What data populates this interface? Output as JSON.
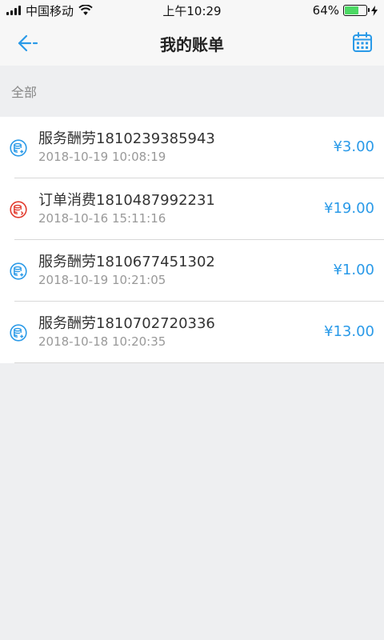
{
  "status_bar": {
    "carrier": "中国移动",
    "time": "上午10:29",
    "battery": "64%",
    "battery_level": 0.64,
    "signal_icon": "signal-icon",
    "wifi_icon": "wifi-icon",
    "charging_icon": "bolt-icon"
  },
  "navbar": {
    "title": "我的账单",
    "back_icon": "back-arrow-icon",
    "calendar_icon": "calendar-icon"
  },
  "section": {
    "label": "全部"
  },
  "colors": {
    "accent": "#2a9ae8",
    "expense": "#e23b2e"
  },
  "bills": [
    {
      "title": "服务酬劳1810239385943",
      "time": "2018-10-19 10:08:19",
      "amount": "¥3.00",
      "type": "income",
      "icon": "income-coin-icon"
    },
    {
      "title": "订单消费1810487992231",
      "time": "2018-10-16 15:11:16",
      "amount": "¥19.00",
      "type": "expense",
      "icon": "expense-coin-icon"
    },
    {
      "title": "服务酬劳1810677451302",
      "time": "2018-10-19 10:21:05",
      "amount": "¥1.00",
      "type": "income",
      "icon": "income-coin-icon"
    },
    {
      "title": "服务酬劳1810702720336",
      "time": "2018-10-18 10:20:35",
      "amount": "¥13.00",
      "type": "income",
      "icon": "income-coin-icon"
    }
  ]
}
